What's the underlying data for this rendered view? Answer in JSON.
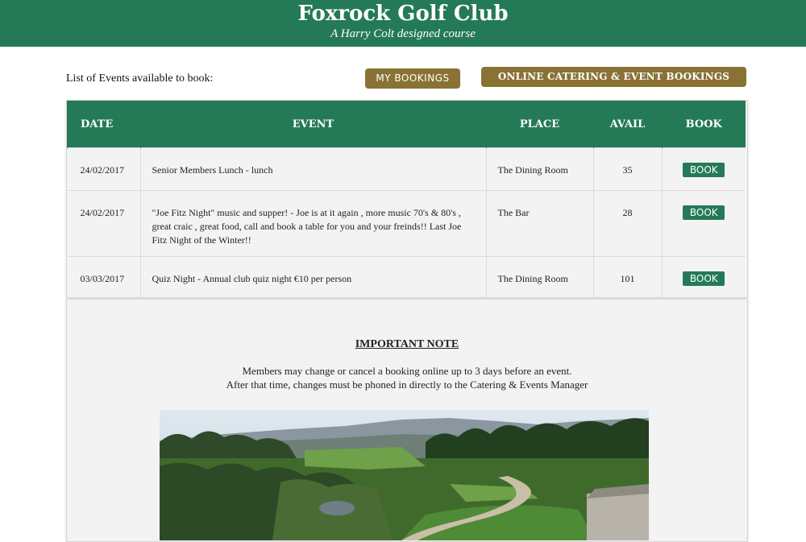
{
  "header": {
    "title": "Foxrock Golf Club",
    "subtitle": "A Harry Colt designed course"
  },
  "toolbar": {
    "list_label": "List of Events available to book:",
    "my_bookings_label": "MY BOOKINGS",
    "catering_label": "ONLINE CATERING & EVENT BOOKINGS"
  },
  "table": {
    "headers": {
      "date": "DATE",
      "event": "EVENT",
      "place": "PLACE",
      "avail": "AVAIL",
      "book": "BOOK"
    },
    "rows": [
      {
        "date": "24/02/2017",
        "event": "Senior Members Lunch - lunch",
        "place": "The Dining Room",
        "avail": "35",
        "book": "BOOK"
      },
      {
        "date": "24/02/2017",
        "event": "\"Joe Fitz Night\" music and supper! - Joe is at it again , more music 70's & 80's , great craic , great food, call and book a table for you and your freinds!! Last Joe Fitz Night of the Winter!!",
        "place": "The Bar",
        "avail": "28",
        "book": "BOOK"
      },
      {
        "date": "03/03/2017",
        "event": "Quiz Night - Annual club quiz night €10 per person",
        "place": "The Dining Room",
        "avail": "101",
        "book": "BOOK"
      }
    ]
  },
  "note": {
    "title": "IMPORTANT NOTE",
    "line1": "Members may change or cancel a booking online up to 3 days before an event.",
    "line2": "After that time, changes must be phoned in directly to the Catering & Events Manager"
  },
  "colors": {
    "brand_green": "#247a56",
    "gold_button": "#8a7235",
    "panel_bg": "#f3f3f3"
  }
}
